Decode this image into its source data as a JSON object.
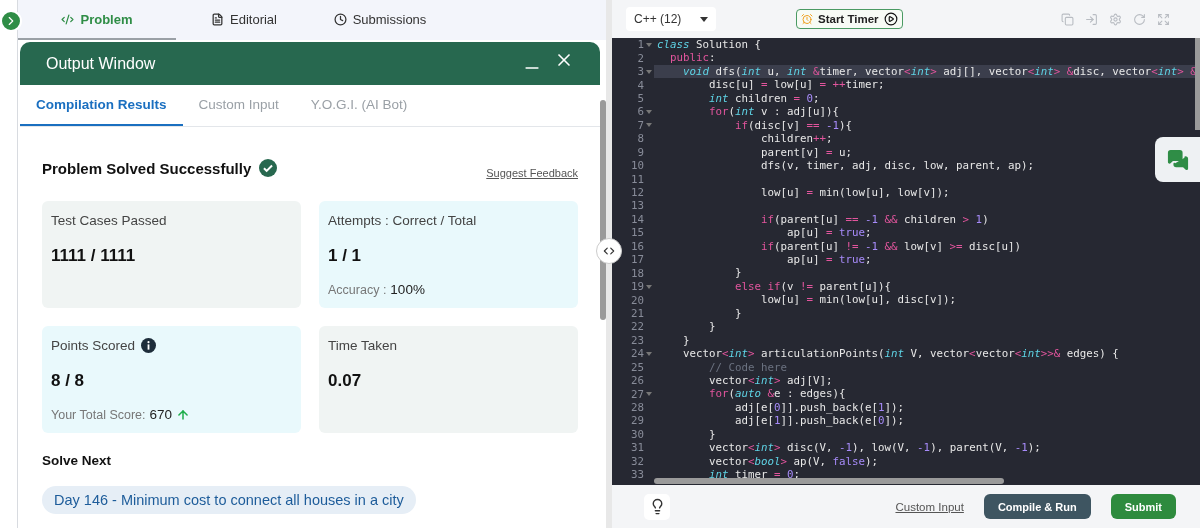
{
  "problem_tabs": [
    {
      "label": "Problem",
      "selected": true
    },
    {
      "label": "Editorial",
      "selected": false
    },
    {
      "label": "Submissions",
      "selected": false
    }
  ],
  "output_window": {
    "title": "Output Window",
    "tabs": [
      {
        "label": "Compilation Results",
        "selected": true
      },
      {
        "label": "Custom Input",
        "selected": false
      },
      {
        "label": "Y.O.G.I. (AI Bot)",
        "selected": false
      }
    ],
    "status": "Problem Solved Successfully",
    "solved": true,
    "feedback_link": "Suggest Feedback",
    "cards": [
      {
        "label": "Test Cases Passed",
        "value": "1111 / 1111",
        "color": "#f0f4f3",
        "info": false
      },
      {
        "label": "Attempts : Correct / Total",
        "value": "1 / 1",
        "color": "#e9f9fc",
        "info": false,
        "detail": {
          "label": "Accuracy :",
          "value": "100%",
          "trend_up": false
        }
      },
      {
        "label": "Points Scored",
        "value": "8 / 8",
        "color": "#e9f9fc",
        "info": true,
        "detail": {
          "label": "Your Total Score:",
          "value": "670",
          "trend_up": true
        }
      },
      {
        "label": "Time Taken",
        "value": "0.07",
        "color": "#f0f4f3",
        "info": false
      }
    ],
    "solve_next": {
      "heading": "Solve Next",
      "items": [
        "Day 146 - Minimum cost to connect all houses in a city"
      ]
    }
  },
  "editor": {
    "language": "C++ (12)",
    "timer_button": "Start Timer",
    "lines": [
      {
        "number": "1",
        "foldable": true,
        "current": false,
        "tokens": [
          {
            "kind": "type",
            "text": "class"
          },
          {
            "kind": "text",
            "text": " Solution {"
          }
        ]
      },
      {
        "number": "2",
        "foldable": false,
        "current": false,
        "tokens": [
          {
            "kind": "kw",
            "text": "  public"
          },
          {
            "kind": "text",
            "text": ":"
          }
        ]
      },
      {
        "number": "3",
        "foldable": true,
        "current": true,
        "tokens": [
          {
            "kind": "type",
            "text": "    void"
          },
          {
            "kind": "text",
            "text": " dfs("
          },
          {
            "kind": "type",
            "text": "int"
          },
          {
            "kind": "text",
            "text": " u, "
          },
          {
            "kind": "type",
            "text": "int"
          },
          {
            "kind": "kw",
            "text": " &"
          },
          {
            "kind": "text",
            "text": "timer, vector"
          },
          {
            "kind": "kw",
            "text": "<"
          },
          {
            "kind": "type",
            "text": "int"
          },
          {
            "kind": "kw",
            "text": ">"
          },
          {
            "kind": "text",
            "text": " adj[], vector"
          },
          {
            "kind": "kw",
            "text": "<"
          },
          {
            "kind": "type",
            "text": "int"
          },
          {
            "kind": "kw",
            "text": ">"
          },
          {
            "kind": "kw",
            "text": " &"
          },
          {
            "kind": "text",
            "text": "disc, vector"
          },
          {
            "kind": "kw",
            "text": "<"
          },
          {
            "kind": "type",
            "text": "int"
          },
          {
            "kind": "kw",
            "text": ">"
          },
          {
            "kind": "kw",
            "text": " &"
          }
        ]
      },
      {
        "number": "4",
        "foldable": false,
        "current": false,
        "tokens": [
          {
            "kind": "text",
            "text": "        disc[u] "
          },
          {
            "kind": "kw",
            "text": "="
          },
          {
            "kind": "text",
            "text": " low[u] "
          },
          {
            "kind": "kw",
            "text": "="
          },
          {
            "kind": "kw",
            "text": " ++"
          },
          {
            "kind": "text",
            "text": "timer;"
          }
        ]
      },
      {
        "number": "5",
        "foldable": false,
        "current": false,
        "tokens": [
          {
            "kind": "type",
            "text": "        int"
          },
          {
            "kind": "text",
            "text": " children "
          },
          {
            "kind": "kw",
            "text": "="
          },
          {
            "kind": "num",
            "text": " 0"
          },
          {
            "kind": "text",
            "text": ";"
          }
        ]
      },
      {
        "number": "6",
        "foldable": true,
        "current": false,
        "tokens": [
          {
            "kind": "kw",
            "text": "        for"
          },
          {
            "kind": "text",
            "text": "("
          },
          {
            "kind": "type",
            "text": "int"
          },
          {
            "kind": "text",
            "text": " v : adj[u]){"
          }
        ]
      },
      {
        "number": "7",
        "foldable": true,
        "current": false,
        "tokens": [
          {
            "kind": "kw",
            "text": "            if"
          },
          {
            "kind": "text",
            "text": "(disc[v] "
          },
          {
            "kind": "kw",
            "text": "=="
          },
          {
            "kind": "num",
            "text": " -1"
          },
          {
            "kind": "text",
            "text": "){"
          }
        ]
      },
      {
        "number": "8",
        "foldable": false,
        "current": false,
        "tokens": [
          {
            "kind": "text",
            "text": "                children"
          },
          {
            "kind": "kw",
            "text": "++"
          },
          {
            "kind": "text",
            "text": ";"
          }
        ]
      },
      {
        "number": "9",
        "foldable": false,
        "current": false,
        "tokens": [
          {
            "kind": "text",
            "text": "                parent[v] "
          },
          {
            "kind": "kw",
            "text": "="
          },
          {
            "kind": "text",
            "text": " u;"
          }
        ]
      },
      {
        "number": "10",
        "foldable": false,
        "current": false,
        "tokens": [
          {
            "kind": "text",
            "text": "                dfs(v, timer, adj, disc, low, parent, ap);"
          }
        ]
      },
      {
        "number": "11",
        "foldable": false,
        "current": false
      },
      {
        "number": "12",
        "foldable": false,
        "current": false,
        "tokens": [
          {
            "kind": "text",
            "text": "                low[u] "
          },
          {
            "kind": "kw",
            "text": "="
          },
          {
            "kind": "text",
            "text": " min(low[u], low[v]);"
          }
        ]
      },
      {
        "number": "13",
        "foldable": false,
        "current": false
      },
      {
        "number": "14",
        "foldable": false,
        "current": false,
        "tokens": [
          {
            "kind": "kw",
            "text": "                if"
          },
          {
            "kind": "text",
            "text": "(parent[u] "
          },
          {
            "kind": "kw",
            "text": "=="
          },
          {
            "kind": "num",
            "text": " -1"
          },
          {
            "kind": "kw",
            "text": " &&"
          },
          {
            "kind": "text",
            "text": " children "
          },
          {
            "kind": "kw",
            "text": ">"
          },
          {
            "kind": "num",
            "text": " 1"
          },
          {
            "kind": "text",
            "text": ")"
          }
        ]
      },
      {
        "number": "15",
        "foldable": false,
        "current": false,
        "tokens": [
          {
            "kind": "text",
            "text": "                    ap[u] "
          },
          {
            "kind": "kw",
            "text": "="
          },
          {
            "kind": "num",
            "text": " true"
          },
          {
            "kind": "text",
            "text": ";"
          }
        ]
      },
      {
        "number": "16",
        "foldable": false,
        "current": false,
        "tokens": [
          {
            "kind": "kw",
            "text": "                if"
          },
          {
            "kind": "text",
            "text": "(parent[u] "
          },
          {
            "kind": "kw",
            "text": "!="
          },
          {
            "kind": "num",
            "text": " -1"
          },
          {
            "kind": "kw",
            "text": " &&"
          },
          {
            "kind": "text",
            "text": " low[v] "
          },
          {
            "kind": "kw",
            "text": ">="
          },
          {
            "kind": "text",
            "text": " disc[u])"
          }
        ]
      },
      {
        "number": "17",
        "foldable": false,
        "current": false,
        "tokens": [
          {
            "kind": "text",
            "text": "                    ap[u] "
          },
          {
            "kind": "kw",
            "text": "="
          },
          {
            "kind": "num",
            "text": " true"
          },
          {
            "kind": "text",
            "text": ";"
          }
        ]
      },
      {
        "number": "18",
        "foldable": false,
        "current": false,
        "tokens": [
          {
            "kind": "text",
            "text": "            }"
          }
        ]
      },
      {
        "number": "19",
        "foldable": true,
        "current": false,
        "tokens": [
          {
            "kind": "kw",
            "text": "            else"
          },
          {
            "kind": "kw",
            "text": " if"
          },
          {
            "kind": "text",
            "text": "(v "
          },
          {
            "kind": "kw",
            "text": "!="
          },
          {
            "kind": "text",
            "text": " parent[u]){"
          }
        ]
      },
      {
        "number": "20",
        "foldable": false,
        "current": false,
        "tokens": [
          {
            "kind": "text",
            "text": "                low[u] "
          },
          {
            "kind": "kw",
            "text": "="
          },
          {
            "kind": "text",
            "text": " min(low[u], disc[v]);"
          }
        ]
      },
      {
        "number": "21",
        "foldable": false,
        "current": false,
        "tokens": [
          {
            "kind": "text",
            "text": "            }"
          }
        ]
      },
      {
        "number": "22",
        "foldable": false,
        "current": false,
        "tokens": [
          {
            "kind": "text",
            "text": "        }"
          }
        ]
      },
      {
        "number": "23",
        "foldable": false,
        "current": false,
        "tokens": [
          {
            "kind": "text",
            "text": "    }"
          }
        ]
      },
      {
        "number": "24",
        "foldable": true,
        "current": false,
        "tokens": [
          {
            "kind": "text",
            "text": "    vector"
          },
          {
            "kind": "kw",
            "text": "<"
          },
          {
            "kind": "type",
            "text": "int"
          },
          {
            "kind": "kw",
            "text": ">"
          },
          {
            "kind": "text",
            "text": " articulationPoints("
          },
          {
            "kind": "type",
            "text": "int"
          },
          {
            "kind": "text",
            "text": " V, vector"
          },
          {
            "kind": "kw",
            "text": "<"
          },
          {
            "kind": "text",
            "text": "vector"
          },
          {
            "kind": "kw",
            "text": "<"
          },
          {
            "kind": "type",
            "text": "int"
          },
          {
            "kind": "kw",
            "text": ">>&"
          },
          {
            "kind": "text",
            "text": " edges) {"
          }
        ]
      },
      {
        "number": "25",
        "foldable": false,
        "current": false,
        "tokens": [
          {
            "kind": "comment",
            "text": "        // Code here"
          }
        ]
      },
      {
        "number": "26",
        "foldable": false,
        "current": false,
        "tokens": [
          {
            "kind": "text",
            "text": "        vector"
          },
          {
            "kind": "kw",
            "text": "<"
          },
          {
            "kind": "type",
            "text": "int"
          },
          {
            "kind": "kw",
            "text": ">"
          },
          {
            "kind": "text",
            "text": " adj[V];"
          }
        ]
      },
      {
        "number": "27",
        "foldable": true,
        "current": false,
        "tokens": [
          {
            "kind": "kw",
            "text": "        for"
          },
          {
            "kind": "text",
            "text": "("
          },
          {
            "kind": "type",
            "text": "auto"
          },
          {
            "kind": "kw",
            "text": " &"
          },
          {
            "kind": "text",
            "text": "e : edges){"
          }
        ]
      },
      {
        "number": "28",
        "foldable": false,
        "current": false,
        "tokens": [
          {
            "kind": "text",
            "text": "            adj[e["
          },
          {
            "kind": "num",
            "text": "0"
          },
          {
            "kind": "text",
            "text": "]].push_back(e["
          },
          {
            "kind": "num",
            "text": "1"
          },
          {
            "kind": "text",
            "text": "]);"
          }
        ]
      },
      {
        "number": "29",
        "foldable": false,
        "current": false,
        "tokens": [
          {
            "kind": "text",
            "text": "            adj[e["
          },
          {
            "kind": "num",
            "text": "1"
          },
          {
            "kind": "text",
            "text": "]].push_back(e["
          },
          {
            "kind": "num",
            "text": "0"
          },
          {
            "kind": "text",
            "text": "]);"
          }
        ]
      },
      {
        "number": "30",
        "foldable": false,
        "current": false,
        "tokens": [
          {
            "kind": "text",
            "text": "        }"
          }
        ]
      },
      {
        "number": "31",
        "foldable": false,
        "current": false,
        "tokens": [
          {
            "kind": "text",
            "text": "        vector"
          },
          {
            "kind": "kw",
            "text": "<"
          },
          {
            "kind": "type",
            "text": "int"
          },
          {
            "kind": "kw",
            "text": ">"
          },
          {
            "kind": "text",
            "text": " disc(V, "
          },
          {
            "kind": "num",
            "text": "-1"
          },
          {
            "kind": "text",
            "text": "), low(V, "
          },
          {
            "kind": "num",
            "text": "-1"
          },
          {
            "kind": "text",
            "text": "), parent(V, "
          },
          {
            "kind": "num",
            "text": "-1"
          },
          {
            "kind": "text",
            "text": ");"
          }
        ]
      },
      {
        "number": "32",
        "foldable": false,
        "current": false,
        "tokens": [
          {
            "kind": "text",
            "text": "        vector"
          },
          {
            "kind": "kw",
            "text": "<"
          },
          {
            "kind": "type",
            "text": "bool"
          },
          {
            "kind": "kw",
            "text": ">"
          },
          {
            "kind": "text",
            "text": " ap(V, "
          },
          {
            "kind": "num",
            "text": "false"
          },
          {
            "kind": "text",
            "text": ");"
          }
        ]
      },
      {
        "number": "33",
        "foldable": false,
        "current": false,
        "tokens": [
          {
            "kind": "type",
            "text": "        int"
          },
          {
            "kind": "text",
            "text": " timer "
          },
          {
            "kind": "kw",
            "text": "="
          },
          {
            "kind": "num",
            "text": " 0"
          },
          {
            "kind": "text",
            "text": ";"
          }
        ]
      }
    ]
  },
  "footer": {
    "custom_input_link": "Custom Input",
    "compile_button": "Compile & Run",
    "submit_button": "Submit"
  }
}
